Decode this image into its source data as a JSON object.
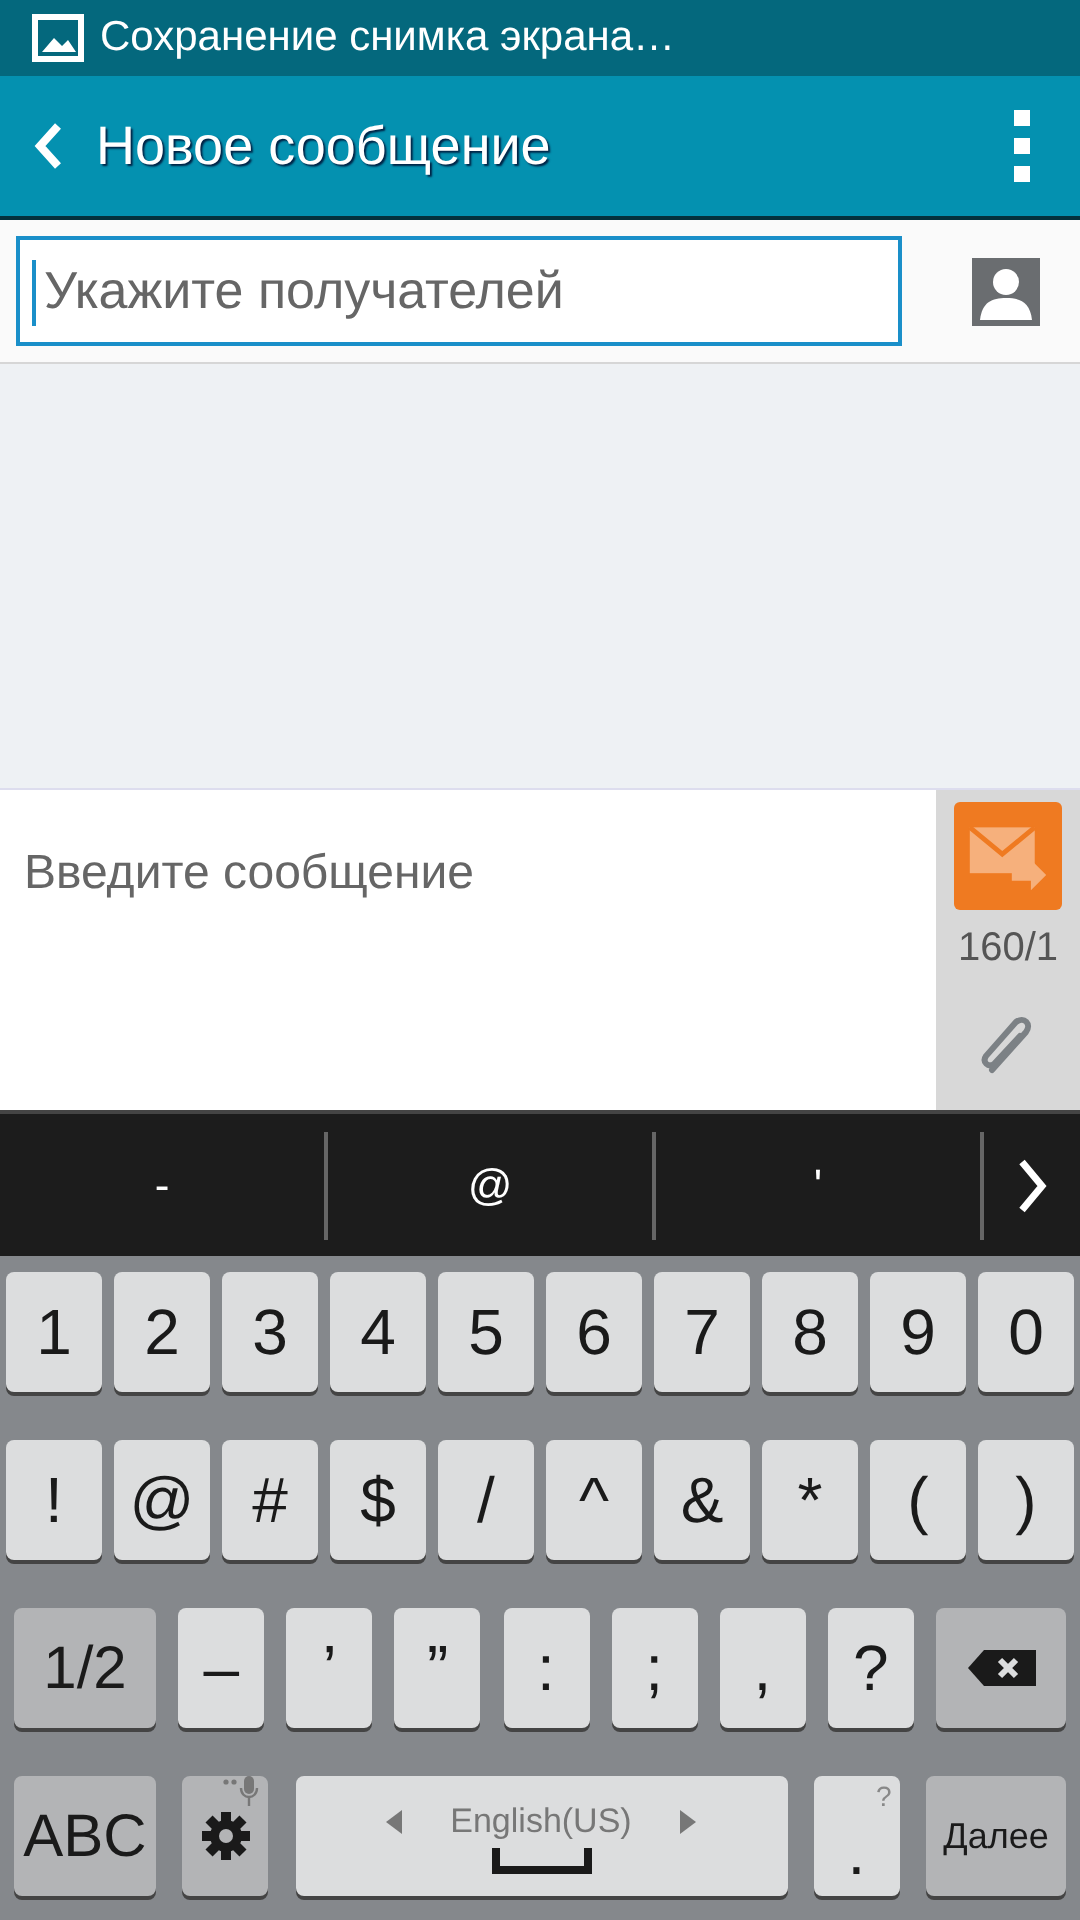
{
  "status_bar": {
    "notification": "Сохранение снимка экрана…"
  },
  "app_bar": {
    "title": "Новое сообщение"
  },
  "recipients": {
    "placeholder": "Укажите получателей"
  },
  "composer": {
    "placeholder": "Введите сообщение",
    "counter": "160/1"
  },
  "suggestions": [
    "-",
    "@",
    "'"
  ],
  "keyboard": {
    "rows": [
      {
        "keys": [
          {
            "kind": "char",
            "label": "1"
          },
          {
            "kind": "char",
            "label": "2"
          },
          {
            "kind": "char",
            "label": "3"
          },
          {
            "kind": "char",
            "label": "4"
          },
          {
            "kind": "char",
            "label": "5"
          },
          {
            "kind": "char",
            "label": "6"
          },
          {
            "kind": "char",
            "label": "7"
          },
          {
            "kind": "char",
            "label": "8"
          },
          {
            "kind": "char",
            "label": "9"
          },
          {
            "kind": "char",
            "label": "0"
          }
        ]
      },
      {
        "keys": [
          {
            "kind": "char",
            "label": "!"
          },
          {
            "kind": "char",
            "label": "@"
          },
          {
            "kind": "char",
            "label": "#"
          },
          {
            "kind": "char",
            "label": "$"
          },
          {
            "kind": "char",
            "label": "/"
          },
          {
            "kind": "char",
            "label": "^"
          },
          {
            "kind": "char",
            "label": "&"
          },
          {
            "kind": "char",
            "label": "*"
          },
          {
            "kind": "char",
            "label": "("
          },
          {
            "kind": "char",
            "label": ")"
          }
        ]
      },
      {
        "keys": [
          {
            "kind": "function",
            "label": "1/2"
          },
          {
            "kind": "char",
            "label": "–"
          },
          {
            "kind": "char",
            "label": "’"
          },
          {
            "kind": "char",
            "label": "”"
          },
          {
            "kind": "char",
            "label": ":"
          },
          {
            "kind": "char",
            "label": ";"
          },
          {
            "kind": "char",
            "label": ","
          },
          {
            "kind": "char",
            "label": "?"
          },
          {
            "kind": "backspace"
          }
        ]
      },
      {
        "keys": [
          {
            "kind": "function",
            "label": "ABC"
          },
          {
            "kind": "settings"
          },
          {
            "kind": "space",
            "label": "English(US)"
          },
          {
            "kind": "period",
            "label": ".",
            "hint": "?"
          },
          {
            "kind": "action",
            "label": "Далее"
          }
        ]
      }
    ]
  }
}
